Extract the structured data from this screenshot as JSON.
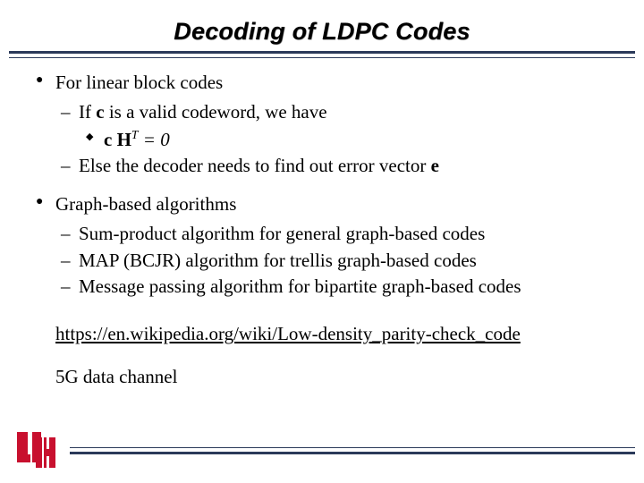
{
  "title": "Decoding of LDPC Codes",
  "b1a": "For linear block codes",
  "b2a_pre": "If ",
  "b2a_c": "c",
  "b2a_post": " is a valid codeword, we have",
  "b3a_c": "c ",
  "b3a_h": "H",
  "b3a_sup": "T",
  "b3a_eq": " = ",
  "b3a_zero": "0",
  "b2b_pre": "Else the decoder needs to find out error vector ",
  "b2b_e": "e",
  "b1b": "Graph-based algorithms",
  "b2c": "Sum-product algorithm for general graph-based codes",
  "b2d": "MAP (BCJR) algorithm for trellis graph-based codes",
  "b2e": "Message passing algorithm for bipartite graph-based codes",
  "link": "https://en.wikipedia.org/wiki/Low-density_parity-check_code",
  "plain": "5G data channel"
}
